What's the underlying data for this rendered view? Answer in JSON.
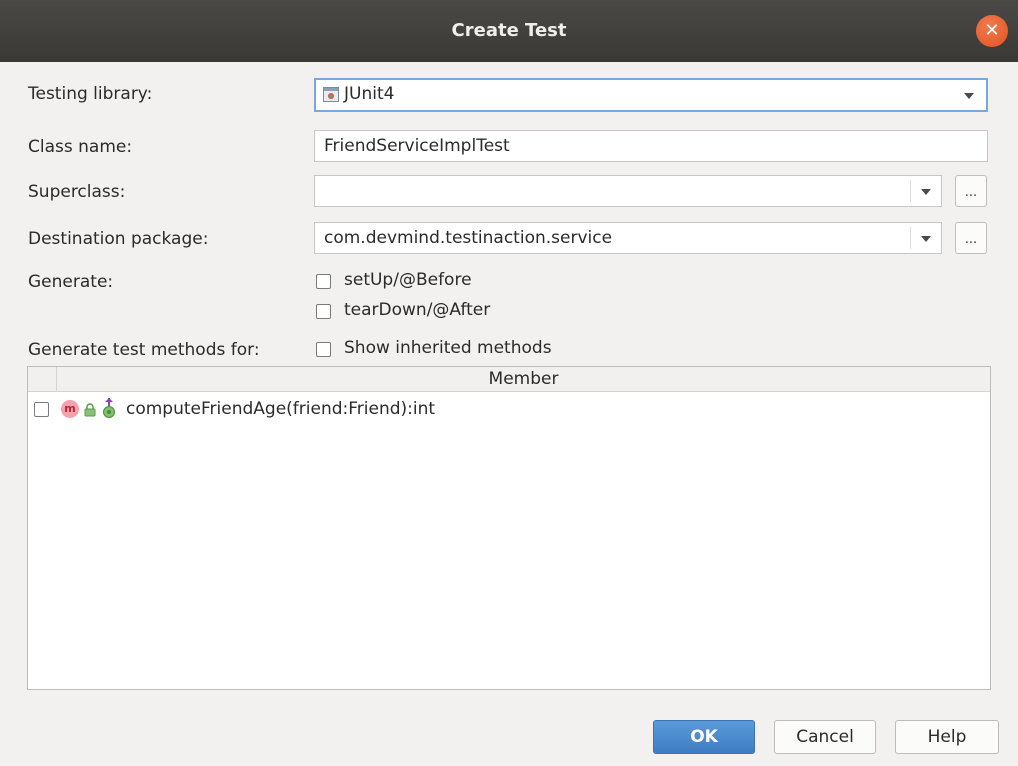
{
  "window": {
    "title": "Create Test"
  },
  "form": {
    "testing_library": {
      "label": "Testing library:",
      "value": "JUnit4"
    },
    "class_name": {
      "label": "Class name:",
      "value": "FriendServiceImplTest"
    },
    "superclass": {
      "label": "Superclass:",
      "value": "",
      "browse_label": "..."
    },
    "destination_package": {
      "label": "Destination package:",
      "value": "com.devmind.testinaction.service",
      "browse_label": "..."
    },
    "generate": {
      "label": "Generate:",
      "options": [
        {
          "label": "setUp/@Before",
          "checked": false
        },
        {
          "label": "tearDown/@After",
          "checked": false
        }
      ]
    },
    "generate_methods": {
      "label": "Generate test methods for:",
      "show_inherited": {
        "label": "Show inherited methods",
        "checked": false
      }
    }
  },
  "members_table": {
    "column_header": "Member",
    "rows": [
      {
        "checked": false,
        "icons": [
          "method-icon",
          "protected-lock-icon",
          "pin-icon"
        ],
        "signature": "computeFriendAge(friend:Friend):int"
      }
    ]
  },
  "buttons": {
    "ok": "OK",
    "cancel": "Cancel",
    "help": "Help"
  },
  "colors": {
    "titlebar": "#3c3b37",
    "close": "#e95420",
    "ok_button": "#4a88cc",
    "focus_border": "#7aa7dd"
  }
}
